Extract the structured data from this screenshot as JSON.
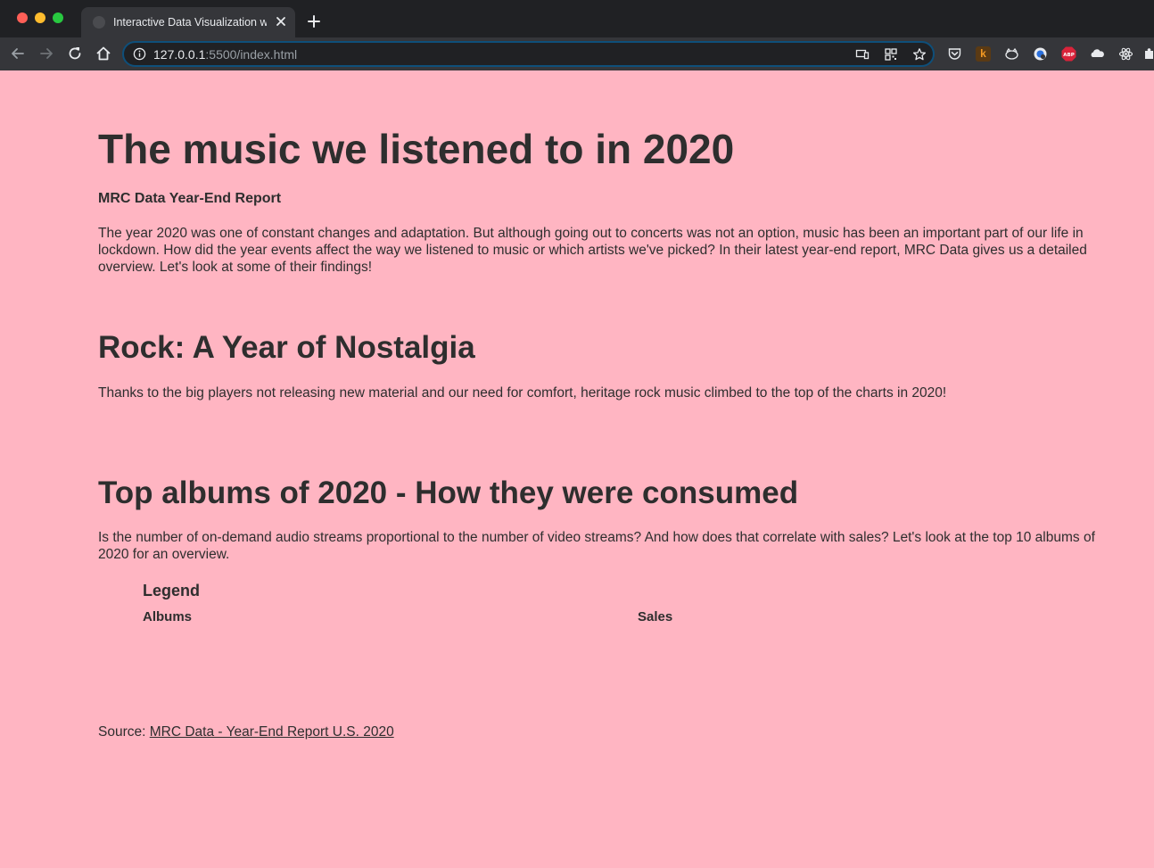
{
  "browser": {
    "tab_title": "Interactive Data Visualization w",
    "url_host": "127.0.0.1",
    "url_rest": ":5500/index.html",
    "extensions": [
      "pocket-icon",
      "k-extension-icon",
      "cat-extension-icon",
      "globe-extension-icon",
      "abp-icon",
      "cloud-extension-icon",
      "react-icon",
      "puzzle-icon"
    ],
    "abp_label": "ABP",
    "k_label": "k"
  },
  "page": {
    "title": "The music we listened to in 2020",
    "subtitle": "MRC Data Year-End Report",
    "intro": "The year 2020 was one of constant changes and adaptation. But although going out to concerts was not an option, music has been an important part of our life in lockdown. How did the year events affect the way we listened to music or which artists we've picked? In their latest year-end report, MRC Data gives us a detailed overview. Let's look at some of their findings!",
    "section1_heading": "Rock: A Year of Nostalgia",
    "section1_text": "Thanks to the big players not releasing new material and our need for comfort, heritage rock music climbed to the top of the charts in 2020!",
    "section2_heading": "Top albums of 2020 - How they were consumed",
    "section2_text": "Is the number of on-demand audio streams proportional to the number of video streams? And how does that correlate with sales? Let's look at the top 10 albums of 2020 for an overview.",
    "legend_title": "Legend",
    "legend_albums": "Albums",
    "legend_sales": "Sales",
    "source_label": "Source:",
    "source_link": "MRC Data - Year-End Report U.S. 2020"
  },
  "colors": {
    "page_background": "#ffb5c2",
    "text": "#2e2e2e",
    "chrome_dark": "#202124",
    "chrome_toolbar": "#35363a"
  }
}
